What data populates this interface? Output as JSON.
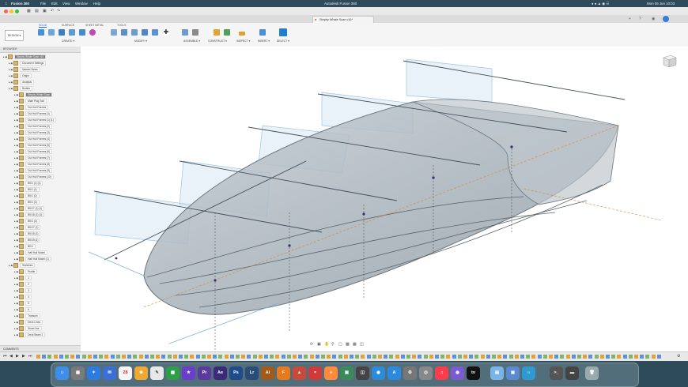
{
  "menubar": {
    "app_name": "Fusion 360",
    "items": [
      "File",
      "Edit",
      "View",
      "Window",
      "Help"
    ],
    "window_title": "Autodesk Fusion 360",
    "clock": "Mon 06 Jun  10:03"
  },
  "document": {
    "tab_label": "Stephy Whale Scan v16*"
  },
  "ribbon": {
    "workspace": "DESIGN ▾",
    "tabs": [
      "SOLID",
      "SURFACE",
      "SHEET METAL",
      "TOOLS"
    ],
    "active_tab": "SOLID",
    "groups": [
      "CREATE ▾",
      "MODIFY ▾",
      "ASSEMBLE ▾",
      "CONSTRUCT ▾",
      "INSPECT ▾",
      "INSERT ▾",
      "SELECT ▾"
    ]
  },
  "browser": {
    "title": "BROWSER",
    "items": [
      {
        "label": "Stephy Whale Scan v16",
        "indent": 0,
        "selected": true
      },
      {
        "label": "Document Settings",
        "indent": 1
      },
      {
        "label": "Named Views",
        "indent": 1
      },
      {
        "label": "Origin",
        "indent": 1
      },
      {
        "label": "Analysis",
        "indent": 1
      },
      {
        "label": "Bodies",
        "indent": 1
      },
      {
        "label": "Stephy Whale Scan",
        "indent": 2,
        "selected": true
      },
      {
        "label": "Main Plug Tool",
        "indent": 2
      },
      {
        "label": "Cut Hull Frames",
        "indent": 2
      },
      {
        "label": "Cut Hull Frames (1)",
        "indent": 2
      },
      {
        "label": "Cut Hull Frames (1) (1)",
        "indent": 2
      },
      {
        "label": "Cut Hull Frames (2)",
        "indent": 2
      },
      {
        "label": "Cut Hull Frames (3)",
        "indent": 2
      },
      {
        "label": "Cut Hull Frames (4)",
        "indent": 2
      },
      {
        "label": "Cut Hull Frames (5)",
        "indent": 2
      },
      {
        "label": "Cut Hull Frames (6)",
        "indent": 2
      },
      {
        "label": "Cut Hull Frames (7)",
        "indent": 2
      },
      {
        "label": "Cut Hull Frames (8)",
        "indent": 2
      },
      {
        "label": "Cut Hull Frames (9)",
        "indent": 2
      },
      {
        "label": "Cut Hull Frames (10)",
        "indent": 2
      },
      {
        "label": "BKG (1) (1)",
        "indent": 2
      },
      {
        "label": "BKG (1)",
        "indent": 2
      },
      {
        "label": "BKG (2)",
        "indent": 2
      },
      {
        "label": "BKG (3)",
        "indent": 2
      },
      {
        "label": "BKG7 (1) (1)",
        "indent": 2
      },
      {
        "label": "BKG8 (1) (1)",
        "indent": 2
      },
      {
        "label": "BKG (4)",
        "indent": 2
      },
      {
        "label": "BKG7 (1)",
        "indent": 2
      },
      {
        "label": "BKG8 (1)",
        "indent": 2
      },
      {
        "label": "BKG9 (1)",
        "indent": 2
      },
      {
        "label": "BKG",
        "indent": 2
      },
      {
        "label": "Half Hull Model",
        "indent": 2
      },
      {
        "label": "Half Hull Model (1)",
        "indent": 2
      },
      {
        "label": "Sketches",
        "indent": 1
      },
      {
        "label": "Profile",
        "indent": 2
      },
      {
        "label": "1",
        "indent": 2
      },
      {
        "label": "2",
        "indent": 2
      },
      {
        "label": "3",
        "indent": 2
      },
      {
        "label": "4",
        "indent": 2
      },
      {
        "label": "5",
        "indent": 2
      },
      {
        "label": "6",
        "indent": 2
      },
      {
        "label": "Transom",
        "indent": 2
      },
      {
        "label": "Deck Lines",
        "indent": 2
      },
      {
        "label": "Sheer line",
        "indent": 2
      },
      {
        "label": "Deck Beam 2",
        "indent": 2
      }
    ]
  },
  "comments": {
    "title": "COMMENTS"
  },
  "dock": {
    "labels": [
      "Pr",
      "Ae",
      "Ps",
      "Lr",
      "Ai",
      "F"
    ],
    "calendar_day": "28",
    "appletv": "tv"
  }
}
